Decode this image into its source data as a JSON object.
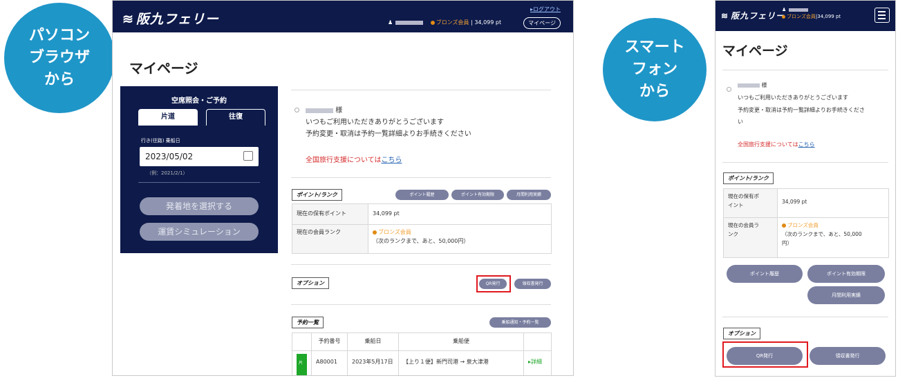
{
  "badges": {
    "pc": [
      "パソコン",
      "ブラウザ",
      "から"
    ],
    "sp": [
      "スマート",
      "フォン",
      "から"
    ]
  },
  "brand": {
    "logo": "阪九フェリー",
    "wave_icon": "wave-icon"
  },
  "pc": {
    "header": {
      "logout": "▸ログアウト",
      "rank": "ブロンズ会員",
      "points": "34,099 pt",
      "mypage": "マイページ"
    },
    "title": "マイページ",
    "booking": {
      "title": "空席照会・ご予約",
      "tab_oneway": "片道",
      "tab_round": "往復",
      "date_label": "行き(往路) 乗船日",
      "date_value": "2023/05/02",
      "example": "（例：2021/2/1）",
      "btn_select": "発着地を選択する",
      "btn_simulation": "運賃シミュレーション"
    },
    "greeting": {
      "suffix": "様",
      "line1": "いつもご利用いただきありがとうございます",
      "line2": "予約変更・取消は予約一覧詳細よりお手続きください"
    },
    "travel": {
      "text": "全国旅行支援については",
      "link": "こちら"
    },
    "points_section": {
      "label": "ポイント/ランク",
      "buttons": [
        "ポイント履歴",
        "ポイント有効期限",
        "月間利用実績"
      ],
      "rows": [
        {
          "head": "現在の保有ポイント",
          "value": "34,099 pt"
        },
        {
          "head": "現在の会員ランク",
          "value": "ブロンズ会員",
          "note": "（次のランクまで、あと、50,000円）"
        }
      ]
    },
    "options": {
      "label": "オプション",
      "qr": "QR発行",
      "receipt": "領収書発行"
    },
    "reservations": {
      "label": "予約一覧",
      "button": "乗船通知・予約一覧",
      "headers": [
        "予約番号",
        "乗船日",
        "乗船便"
      ],
      "row": {
        "tag": "片道",
        "number": "A80001",
        "date": "2023年5月17日",
        "route": "【上り１便】新門司港 → 泉大津港",
        "detail": "▸詳細"
      }
    }
  },
  "sp": {
    "header": {
      "rank": "ブロンズ会員",
      "points": "34,099 pt"
    },
    "title": "マイページ",
    "greeting": {
      "suffix": "様",
      "line1": "いつもご利用いただきありがとうございます",
      "line2": "予約変更・取消は予約一覧詳細よりお手続きくださ",
      "line3": "い"
    },
    "travel": {
      "text": "全国旅行支援については",
      "link": "こちら"
    },
    "points_section": {
      "label": "ポイント/ランク",
      "row1_head_a": "現在の保有ポ",
      "row1_head_b": "イント",
      "row1_value": "34,099 pt",
      "row2_head_a": "現在の会員ラ",
      "row2_head_b": "ンク",
      "row2_value": "ブロンズ会員",
      "row2_note_a": "（次のランクまで、あと、50,000",
      "row2_note_b": "円）",
      "buttons": [
        "ポイント履歴",
        "ポイント有効期限",
        "月間利用実績"
      ]
    },
    "options": {
      "label": "オプション",
      "qr": "QR発行",
      "receipt": "領収書発行"
    }
  },
  "colors": {
    "navy": "#0d1a4a",
    "badge_blue": "#1f96c8",
    "highlight_red": "#e0181e",
    "bronze": "#e08a14"
  }
}
